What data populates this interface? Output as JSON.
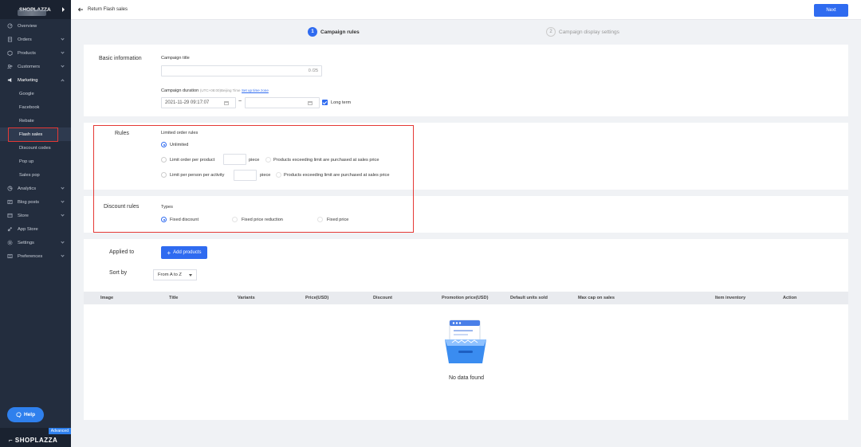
{
  "sidebar": {
    "store_name": "SHOPLAZZA",
    "items": [
      {
        "label": "Overview",
        "icon": "overview-icon"
      },
      {
        "label": "Orders",
        "icon": "orders-icon"
      },
      {
        "label": "Products",
        "icon": "products-icon"
      },
      {
        "label": "Customers",
        "icon": "customers-icon"
      },
      {
        "label": "Marketing",
        "icon": "marketing-icon"
      },
      {
        "label": "Google"
      },
      {
        "label": "Facebook"
      },
      {
        "label": "Rebate"
      },
      {
        "label": "Flash sales"
      },
      {
        "label": "Discount codes"
      },
      {
        "label": "Pop up"
      },
      {
        "label": "Sales pop"
      },
      {
        "label": "Analytics",
        "icon": "analytics-icon"
      },
      {
        "label": "Blog posts",
        "icon": "blog-icon"
      },
      {
        "label": "Store",
        "icon": "store-icon"
      },
      {
        "label": "App Store",
        "icon": "app-store-icon"
      },
      {
        "label": "Settings",
        "icon": "settings-icon"
      },
      {
        "label": "Preferences",
        "icon": "preferences-icon"
      }
    ],
    "help_label": "Help",
    "badge": "Advanced",
    "logo_text": "SHOPLAZZA"
  },
  "topbar": {
    "back_label": "Return Flash sales",
    "next_label": "Next"
  },
  "steps": [
    {
      "num": "1",
      "label": "Campaign rules"
    },
    {
      "num": "2",
      "label": "Campaign display settings"
    }
  ],
  "basic": {
    "title": "Basic information",
    "campaign_title_label": "Campaign title",
    "campaign_title_counter": "0 /25",
    "duration_label": "Campaign duration",
    "timezone": "(UTC+08:00)Beijing Time",
    "timezone_link": "Set up time zone",
    "start_date": "2021-11-29 09:17:07",
    "date_separator": "~",
    "long_term_label": "Long term"
  },
  "rules": {
    "title": "Rules",
    "limited_label": "Limited order rules",
    "unlimited": "Unlimited",
    "per_product": "Limit order per product",
    "piece": "piece",
    "exceeding_note": "Products exceeding limit are purchased at sales price",
    "per_person": "Limit per person per activity"
  },
  "discount": {
    "title": "Discount rules",
    "types_label": "Types",
    "options": [
      "Fixed discount",
      "Fixed price reduction",
      "Fixed price"
    ]
  },
  "products": {
    "applied_to": "Applied to",
    "add_label": "Add products",
    "sort_by": "Sort by",
    "sort_value": "From A to Z",
    "columns": [
      "Image",
      "Title",
      "Variants",
      "Price(USD)",
      "Discount",
      "Promotion price(USD)",
      "Default units sold",
      "Max cap on sales",
      "Item inventory",
      "Action"
    ],
    "empty_text": "No data found"
  },
  "colors": {
    "primary": "#2f6bf0",
    "highlight": "#e53935",
    "sidebar": "#232d3e"
  }
}
